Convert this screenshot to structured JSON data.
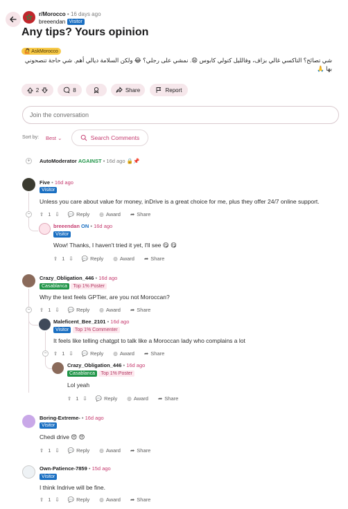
{
  "post": {
    "subreddit": "r/Morocco",
    "time": "16 days ago",
    "author": "breeendan",
    "author_badge": "Visitor",
    "title": "Any tips? Yours opinion",
    "flair": "AskMorocco",
    "body": "شي تصائح؟ التاكسي غالي بزاف، وفالليل كتولي كابوس 😩. نمشي على رجلي؟ 😂 ولكن السلامة ديالي أهم. شي حاجة تنصحوني بها 🙏",
    "votes": "2",
    "comments": "8",
    "share_label": "Share",
    "report_label": "Report"
  },
  "join": {
    "placeholder": "Join the conversation"
  },
  "sort": {
    "label": "Sort by:",
    "value": "Best",
    "search_label": "Search Comments"
  },
  "automod": {
    "name": "AutoModerator",
    "tag": "AGAINST",
    "time": "16d ago"
  },
  "actions": {
    "reply": "Reply",
    "award": "Award",
    "share": "Share"
  },
  "comments": [
    {
      "author": "Five",
      "time": "16d ago",
      "badge": "Visitor",
      "text": "Unless you care about value for money, inDrive is a great choice for me, plus they offer 24/7 online support.",
      "votes": "1"
    },
    {
      "author": "breeendan",
      "op": "ON",
      "time": "16d ago",
      "badge": "Visitor",
      "text": "Wow! Thanks, I haven't tried it yet, I'll see 😋 😋",
      "votes": "1"
    },
    {
      "author": "Crazy_Obligation_446",
      "time": "16d ago",
      "city": "Casablanca",
      "top": "Top 1% Poster",
      "text": "Why the text feels GPTier, are you not Moroccan?",
      "votes": "1"
    },
    {
      "author": "Maleficent_Bee_2101",
      "time": "16d ago",
      "badge": "Visitor",
      "top": "Top 1% Commenter",
      "text": "It feels like telling chatgpt to talk like a Moroccan lady who complains a lot",
      "votes": "1"
    },
    {
      "author": "Crazy_Obligation_446",
      "time": "16d ago",
      "city": "Casablanca",
      "top": "Top 1% Poster",
      "text": "Lol yeah",
      "votes": "1"
    },
    {
      "author": "Boring-Extreme-",
      "time": "16d ago",
      "badge": "Visitor",
      "text": "Chedi drive 😍 😍",
      "votes": "1"
    },
    {
      "author": "Own-Patience-7859",
      "time": "15d ago",
      "badge": "Visitor",
      "text": "I think Indrive will be fine.",
      "votes": "1"
    }
  ],
  "colors": {
    "accent": "#c53a6e",
    "visitor": "#1a6fc2",
    "city": "#1f9447",
    "pill": "#f6e7eb"
  }
}
